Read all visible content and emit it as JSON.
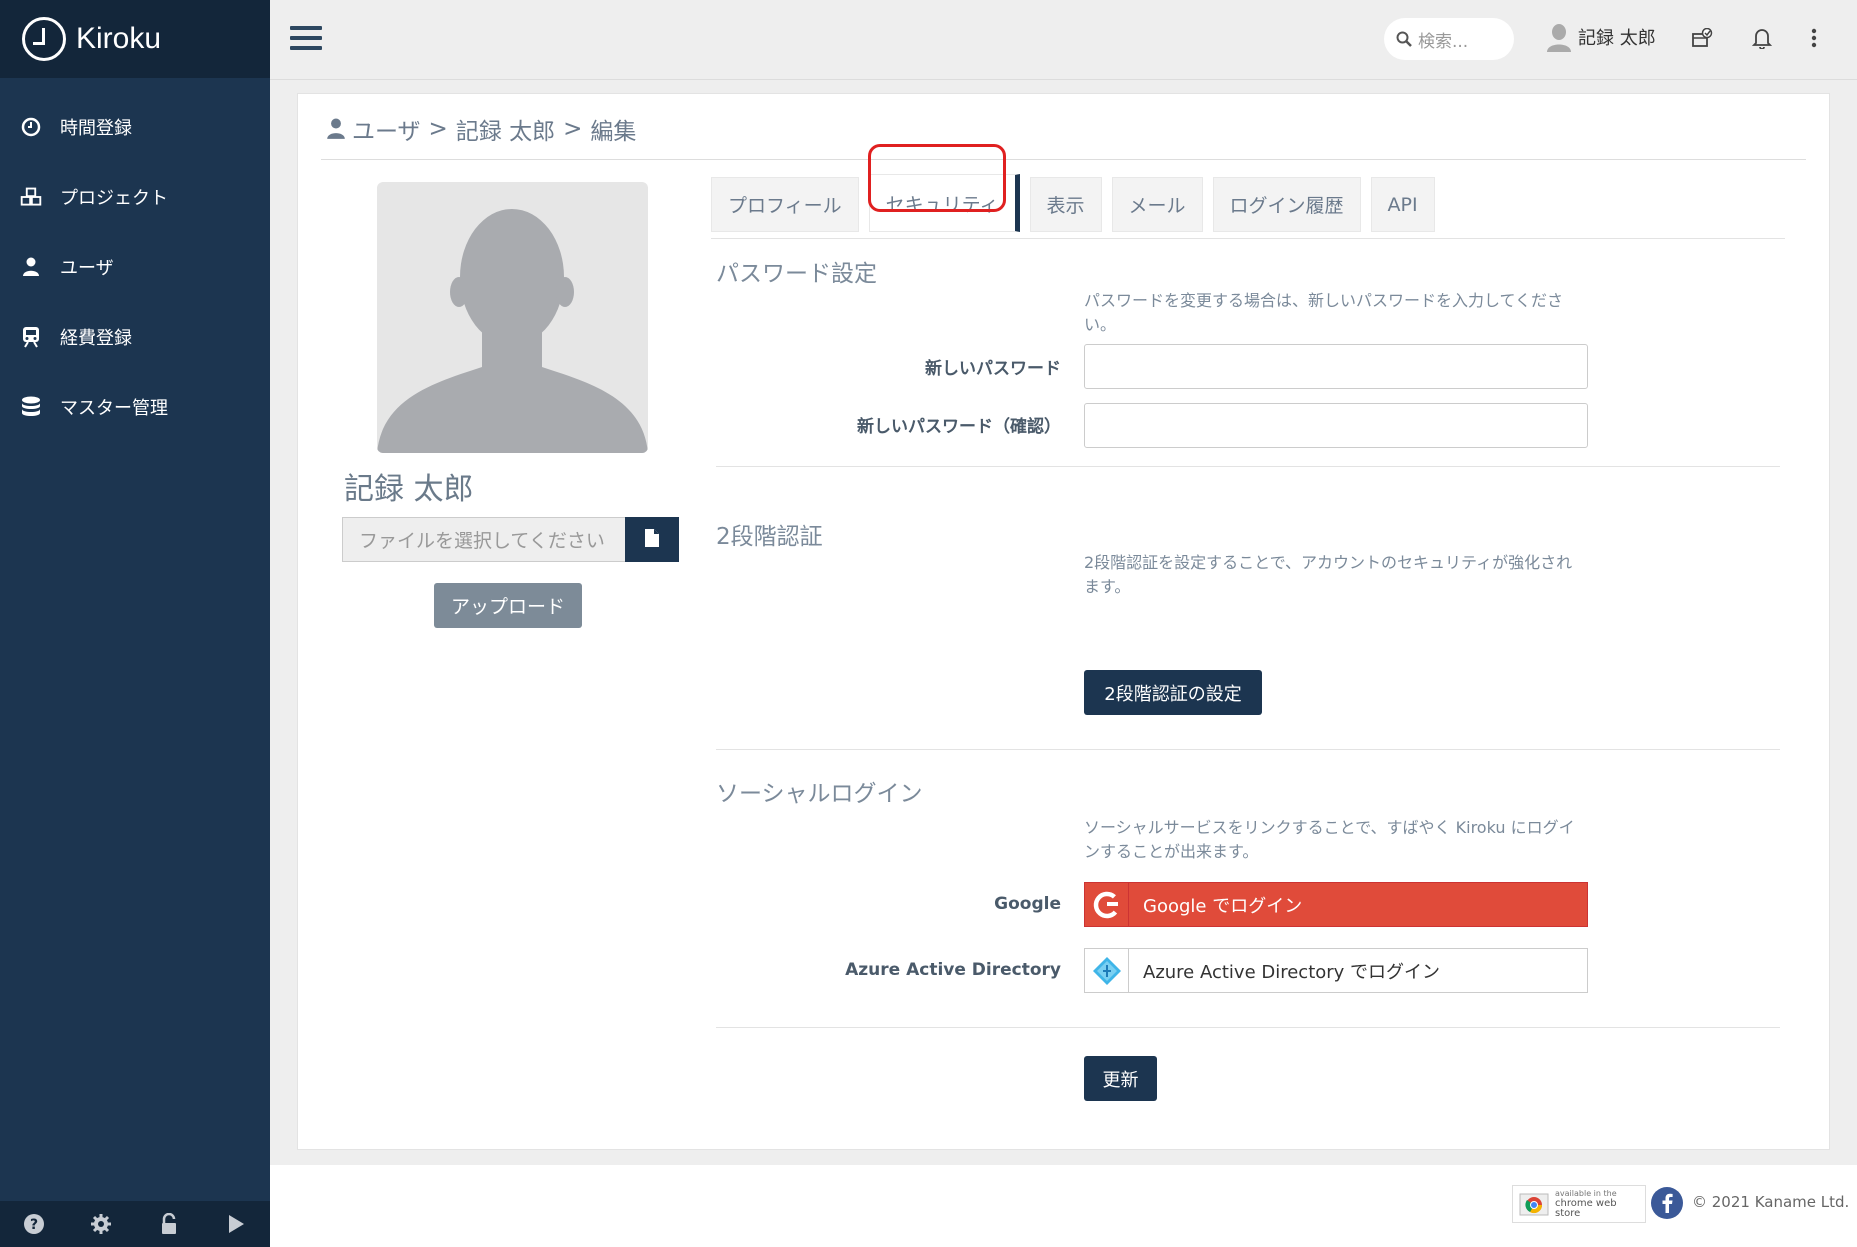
{
  "app": {
    "name": "Kiroku"
  },
  "sidebar": {
    "items": [
      {
        "label": "時間登録",
        "icon": "clock-icon"
      },
      {
        "label": "プロジェクト",
        "icon": "cubes-icon"
      },
      {
        "label": "ユーザ",
        "icon": "user-icon"
      },
      {
        "label": "経費登録",
        "icon": "train-icon"
      },
      {
        "label": "マスター管理",
        "icon": "database-icon"
      }
    ],
    "footer_icons": [
      "help-icon",
      "gear-icon",
      "unlock-icon",
      "play-icon"
    ]
  },
  "topbar": {
    "search_placeholder": "検索...",
    "user_name": "記録 太郎"
  },
  "breadcrumb": {
    "items": [
      "ユーザ",
      "記録 太郎",
      "編集"
    ],
    "separator": ">"
  },
  "profile": {
    "name": "記録 太郎",
    "file_placeholder": "ファイルを選択してください",
    "upload_label": "アップロード"
  },
  "tabs": [
    {
      "label": "プロフィール",
      "active": false
    },
    {
      "label": "セキュリティ",
      "active": true
    },
    {
      "label": "表示",
      "active": false
    },
    {
      "label": "メール",
      "active": false
    },
    {
      "label": "ログイン履歴",
      "active": false
    },
    {
      "label": "API",
      "active": false
    }
  ],
  "password": {
    "title": "パスワード設定",
    "help": "パスワードを変更する場合は、新しいパスワードを入力してください。",
    "new_label": "新しいパスワード",
    "new_value": "",
    "confirm_label": "新しいパスワード（確認）",
    "confirm_value": ""
  },
  "twofactor": {
    "title": "2段階認証",
    "help": "2段階認証を設定することで、アカウントのセキュリティが強化されます。",
    "button": "2段階認証の設定"
  },
  "social": {
    "title": "ソーシャルログイン",
    "help": "ソーシャルサービスをリンクすることで、すばやく Kiroku にログインすることが出来ます。",
    "google_label": "Google",
    "google_button": "Google でログイン",
    "azure_label": "Azure Active Directory",
    "azure_button": "Azure Active Directory でログイン"
  },
  "update_button": "更新",
  "footer": {
    "chrome_store_line1": "available in the",
    "chrome_store_line2": "chrome web store",
    "copyright": "© 2021 Kaname Ltd."
  },
  "colors": {
    "sidebar": "#1c3550",
    "brand_bar": "#13263a",
    "google": "#e04b3a",
    "highlight": "#e02020"
  }
}
